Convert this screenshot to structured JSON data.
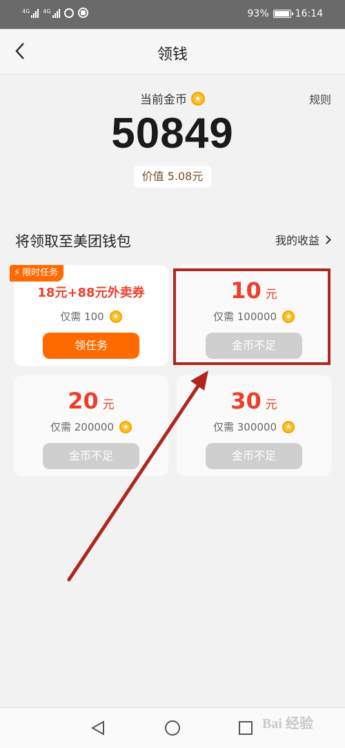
{
  "status_bar": {
    "signal1_tag": "4G",
    "signal2_tag": "4G",
    "battery_percent": "93%",
    "time": "16:14",
    "icons": [
      "signal-icon",
      "signal-icon",
      "alarm-icon",
      "app-notification-icon",
      "battery-icon"
    ]
  },
  "header": {
    "title": "领钱",
    "back_icon": "chevron-left-icon"
  },
  "coins": {
    "label": "当前金币",
    "coin_icon_glyph": "★",
    "balance": "50849",
    "value_text": "价值 5.08元",
    "rules_label": "规则"
  },
  "section": {
    "title": "将领取至美团钱包",
    "earnings_link": "我的收益"
  },
  "cards": [
    {
      "tag": "限时任务",
      "tag_icon": "⚡",
      "promo": "18元+88元外卖券",
      "need": "仅需 100",
      "button": "领任务"
    },
    {
      "amount": "10",
      "unit": "元",
      "need": "仅需 100000",
      "button": "金币不足"
    },
    {
      "amount": "20",
      "unit": "元",
      "need": "仅需 200000",
      "button": "金币不足"
    },
    {
      "amount": "30",
      "unit": "元",
      "need": "仅需 300000",
      "button": "金币不足"
    }
  ],
  "annotation": {
    "color": "#b0261e"
  },
  "bottom_nav": {
    "icons": [
      "back-triangle-icon",
      "home-circle-icon",
      "recent-square-icon"
    ]
  },
  "watermark": "Bai 经验",
  "colors": {
    "accent_orange": "#ff6a00",
    "price_red": "#ee3e2a",
    "coin_gold": "#fbbf22",
    "disabled_button": "#cfcfcf"
  }
}
